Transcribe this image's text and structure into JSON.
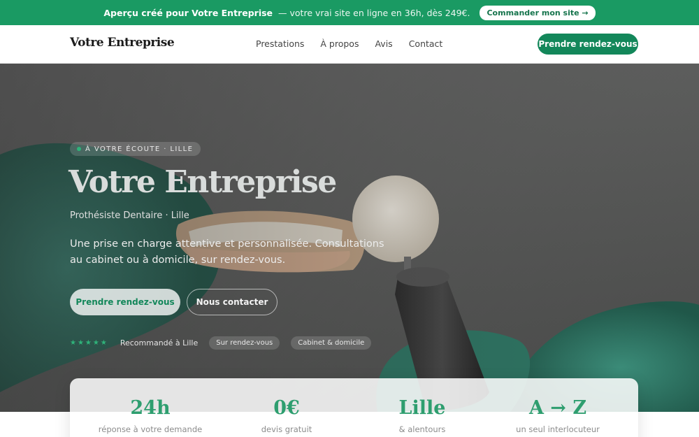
{
  "banner": {
    "strong": "Aperçu créé pour Votre Entreprise",
    "rest": "— votre vrai site en ligne en 36h, dès 249€.",
    "cta": "Commander mon site →"
  },
  "nav": {
    "brand": "Votre Entreprise",
    "links": [
      "Prestations",
      "À propos",
      "Avis",
      "Contact"
    ],
    "cta": "Prendre rendez-vous"
  },
  "hero": {
    "eyebrow": "À VOTRE ÉCOUTE · LILLE",
    "title": "Votre Entreprise",
    "subtitle": "Prothésiste Dentaire · Lille",
    "description": "Une prise en charge attentive et personnalisée. Consultations au cabinet ou à domicile, sur rendez-vous.",
    "primary_cta": "Prendre rendez-vous",
    "secondary_cta": "Nous contacter",
    "stars": "★★★★★",
    "rating_text": "Recommandé à Lille",
    "chips": [
      "Sur rendez-vous",
      "Cabinet & domicile"
    ]
  },
  "stats": [
    {
      "value": "24h",
      "label": "réponse à votre demande"
    },
    {
      "value": "0€",
      "label": "devis gratuit"
    },
    {
      "value": "Lille",
      "label": "& alentours"
    },
    {
      "value": "A → Z",
      "label": "un seul interlocuteur"
    }
  ],
  "colors": {
    "accent": "#13875a",
    "banner_bg": "#1a9a63",
    "stat_value": "#2e9e6f"
  }
}
